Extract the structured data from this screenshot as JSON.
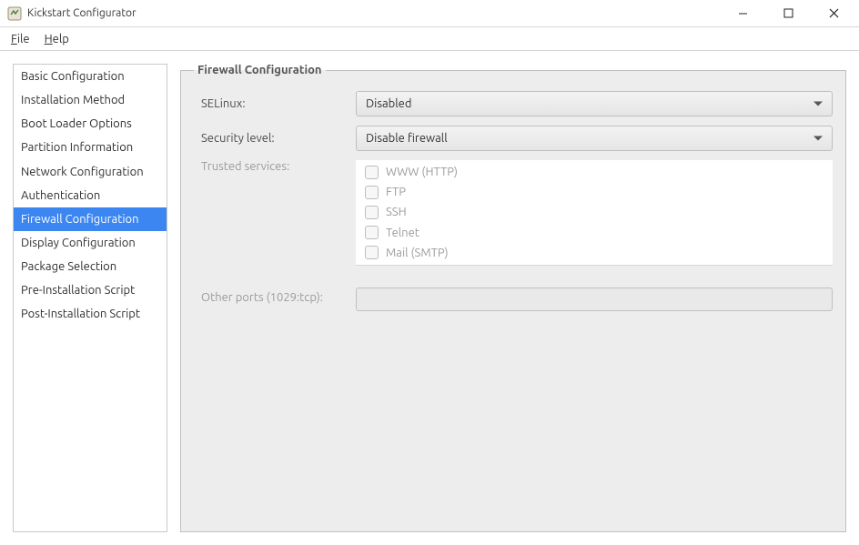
{
  "window": {
    "title": "Kickstart Configurator"
  },
  "menu": {
    "file": "File",
    "help": "Help"
  },
  "sidebar": {
    "items": [
      {
        "label": "Basic Configuration"
      },
      {
        "label": "Installation Method"
      },
      {
        "label": "Boot Loader Options"
      },
      {
        "label": "Partition Information"
      },
      {
        "label": "Network Configuration"
      },
      {
        "label": "Authentication"
      },
      {
        "label": "Firewall Configuration",
        "selected": true
      },
      {
        "label": "Display Configuration"
      },
      {
        "label": "Package Selection"
      },
      {
        "label": "Pre-Installation Script"
      },
      {
        "label": "Post-Installation Script"
      }
    ]
  },
  "panel": {
    "legend": "Firewall Configuration",
    "selinux": {
      "label": "SELinux:",
      "value": "Disabled"
    },
    "security_level": {
      "label": "Security level:",
      "value": "Disable firewall"
    },
    "trusted": {
      "label": "Trusted services:",
      "services": [
        {
          "label": "WWW (HTTP)"
        },
        {
          "label": "FTP"
        },
        {
          "label": "SSH"
        },
        {
          "label": "Telnet"
        },
        {
          "label": "Mail (SMTP)"
        }
      ]
    },
    "other_ports": {
      "label": "Other ports (1029:tcp):",
      "value": ""
    }
  }
}
